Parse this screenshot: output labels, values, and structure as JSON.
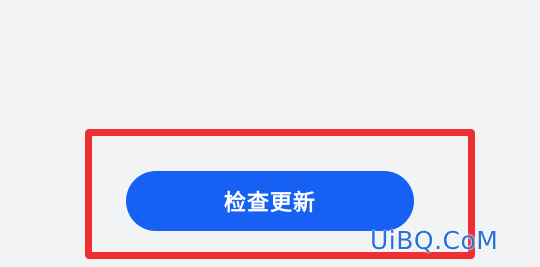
{
  "main": {
    "update_button_label": "检查更新"
  },
  "annotation": {
    "highlight_color": "#ee2f34"
  },
  "watermark": {
    "text": "UiBQ.CoM"
  },
  "colors": {
    "background": "#f2f3f5",
    "button": "#1660f4",
    "watermark": "#2c72d6"
  }
}
